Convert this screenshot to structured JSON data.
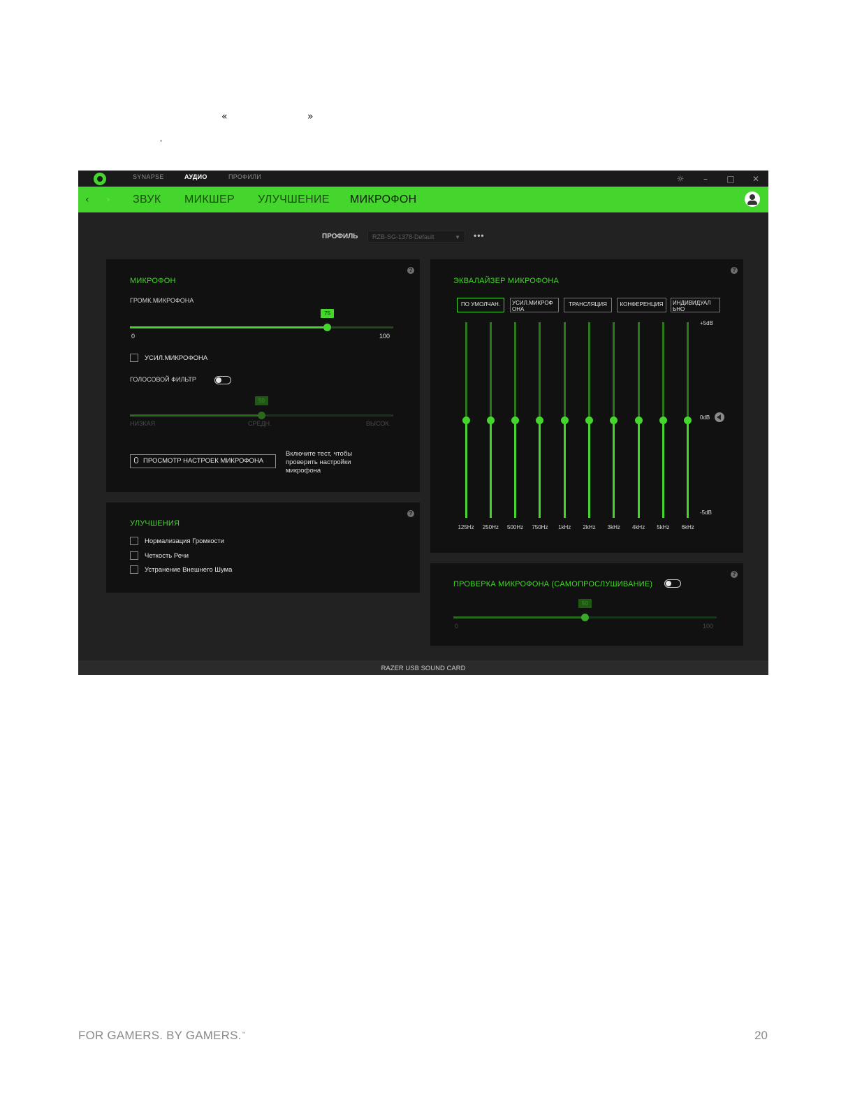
{
  "document": {
    "nav_prev_glyph": "«",
    "nav_next_glyph": "»",
    "stray_mark": "'",
    "footer_left": "FOR GAMERS. BY GAMERS.",
    "footer_tm": "™",
    "page_number": "20"
  },
  "window": {
    "tabs": [
      "SYNAPSE",
      "АУДИО",
      "ПРОФИЛИ"
    ],
    "active_tab": "АУДИО",
    "icons": [
      "razer-logo-icon",
      "gear-icon",
      "minimize-icon",
      "maximize-icon",
      "close-icon"
    ]
  },
  "nav": {
    "tabs": [
      "ЗВУК",
      "МИКШЕР",
      "УЛУЧШЕНИЕ",
      "МИКРОФОН"
    ],
    "active_tab": "МИКРОФОН"
  },
  "profile": {
    "label": "ПРОФИЛЬ",
    "selected": "RZB-SG-1378-Default",
    "more": "•••"
  },
  "mic_panel": {
    "title": "МИКРОФОН",
    "volume_label": "ГРОМК.МИКРОФОНА",
    "volume_value": 75,
    "volume_min": "0",
    "volume_max": "100",
    "boost_label": "УСИЛ.МИКРОФОНА",
    "boost_checked": false,
    "voice_filter_label": "ГОЛОСОВОЙ ФИЛЬТР",
    "voice_filter_on": false,
    "sensitivity_value": 50,
    "sensitivity_low": "НИЗКАЯ",
    "sensitivity_mid": "СРЕДН.",
    "sensitivity_high": "ВЫСОК.",
    "preview_button": "ПРОСМОТР НАСТРОЕК МИКРОФОНА",
    "hint_lines": [
      "Включите тест, чтобы",
      "проверить настройки",
      "микрофона"
    ]
  },
  "enhancements_panel": {
    "title": "УЛУЧШЕНИЯ",
    "items": [
      {
        "label": "Нормализация Громкости",
        "checked": false
      },
      {
        "label": "Четкость Речи",
        "checked": false
      },
      {
        "label": "Устранение Внешнего Шума",
        "checked": false
      }
    ]
  },
  "eq_panel": {
    "title": "ЭКВАЛАЙЗЕР МИКРОФОНА",
    "presets": [
      {
        "lines": [
          "ПО УМОЛЧАН."
        ],
        "active": true
      },
      {
        "lines": [
          "УСИЛ.МИКРОФ",
          "ОНА"
        ],
        "active": false
      },
      {
        "lines": [
          "ТРАНСЛЯЦИЯ"
        ],
        "active": false
      },
      {
        "lines": [
          "КОНФЕРЕНЦИЯ"
        ],
        "active": false
      },
      {
        "lines": [
          "ИНДИВИДУАЛ",
          "ЬНО"
        ],
        "active": false
      }
    ],
    "db_top": "+5dB",
    "db_mid": "0dB",
    "db_bottom": "-5dB",
    "db_range": [
      -5,
      5
    ],
    "bands": [
      {
        "freq": "125Hz",
        "gain": 0
      },
      {
        "freq": "250Hz",
        "gain": 0
      },
      {
        "freq": "500Hz",
        "gain": 0
      },
      {
        "freq": "750Hz",
        "gain": 0
      },
      {
        "freq": "1kHz",
        "gain": 0
      },
      {
        "freq": "2kHz",
        "gain": 0
      },
      {
        "freq": "3kHz",
        "gain": 0
      },
      {
        "freq": "4kHz",
        "gain": 0
      },
      {
        "freq": "5kHz",
        "gain": 0
      },
      {
        "freq": "6kHz",
        "gain": 0
      }
    ]
  },
  "monitor_panel": {
    "title": "ПРОВЕРКА МИКРОФОНА (САМОПРОСЛУШИВАНИЕ)",
    "enabled": false,
    "value": 50,
    "min": "0",
    "max": "100"
  },
  "status": {
    "device": "RAZER USB SOUND CARD"
  },
  "colors": {
    "accent": "#44d62c",
    "panel": "#111111",
    "window_bg": "#222222"
  }
}
